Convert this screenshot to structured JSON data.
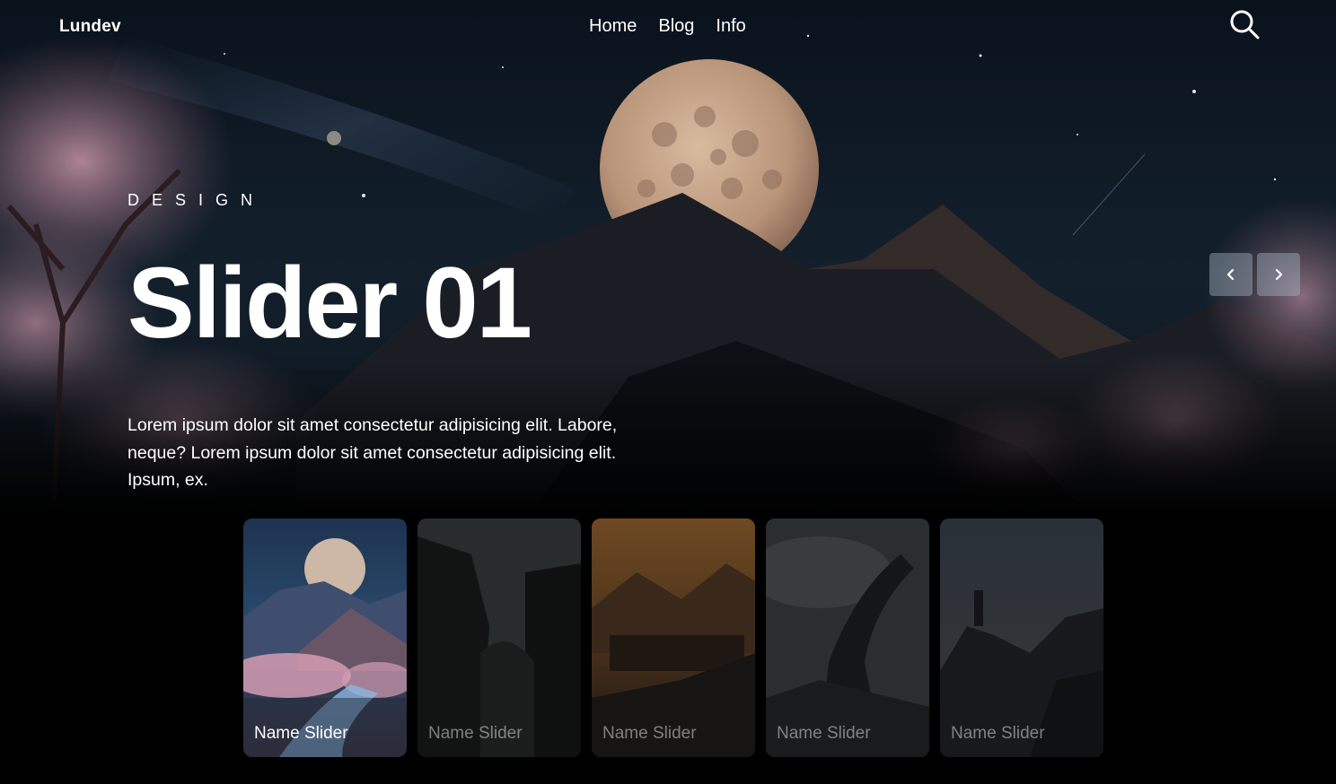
{
  "header": {
    "logo": "Lundev",
    "nav": [
      {
        "label": "Home"
      },
      {
        "label": "Blog"
      },
      {
        "label": "Info"
      }
    ],
    "search_icon": "search-icon"
  },
  "hero": {
    "eyebrow": "DESIGN",
    "title": "Slider 01",
    "description": "Lorem ipsum dolor sit amet consectetur adipisicing elit. Labore, neque? Lorem ipsum dolor sit amet consectetur adipisicing elit. Ipsum, ex."
  },
  "arrows": {
    "prev_icon": "chevron-left-icon",
    "next_icon": "chevron-right-icon"
  },
  "thumbnails": [
    {
      "label": "Name Slider",
      "active": true
    },
    {
      "label": "Name Slider",
      "active": false
    },
    {
      "label": "Name Slider",
      "active": false
    },
    {
      "label": "Name Slider",
      "active": false
    },
    {
      "label": "Name Slider",
      "active": false
    }
  ],
  "colors": {
    "sky_top": "#0b1420",
    "sky_mid": "#14222f",
    "moon": "#c9a98c",
    "blossom": "#c996a8",
    "arrow_bg": "#aab9c8"
  }
}
